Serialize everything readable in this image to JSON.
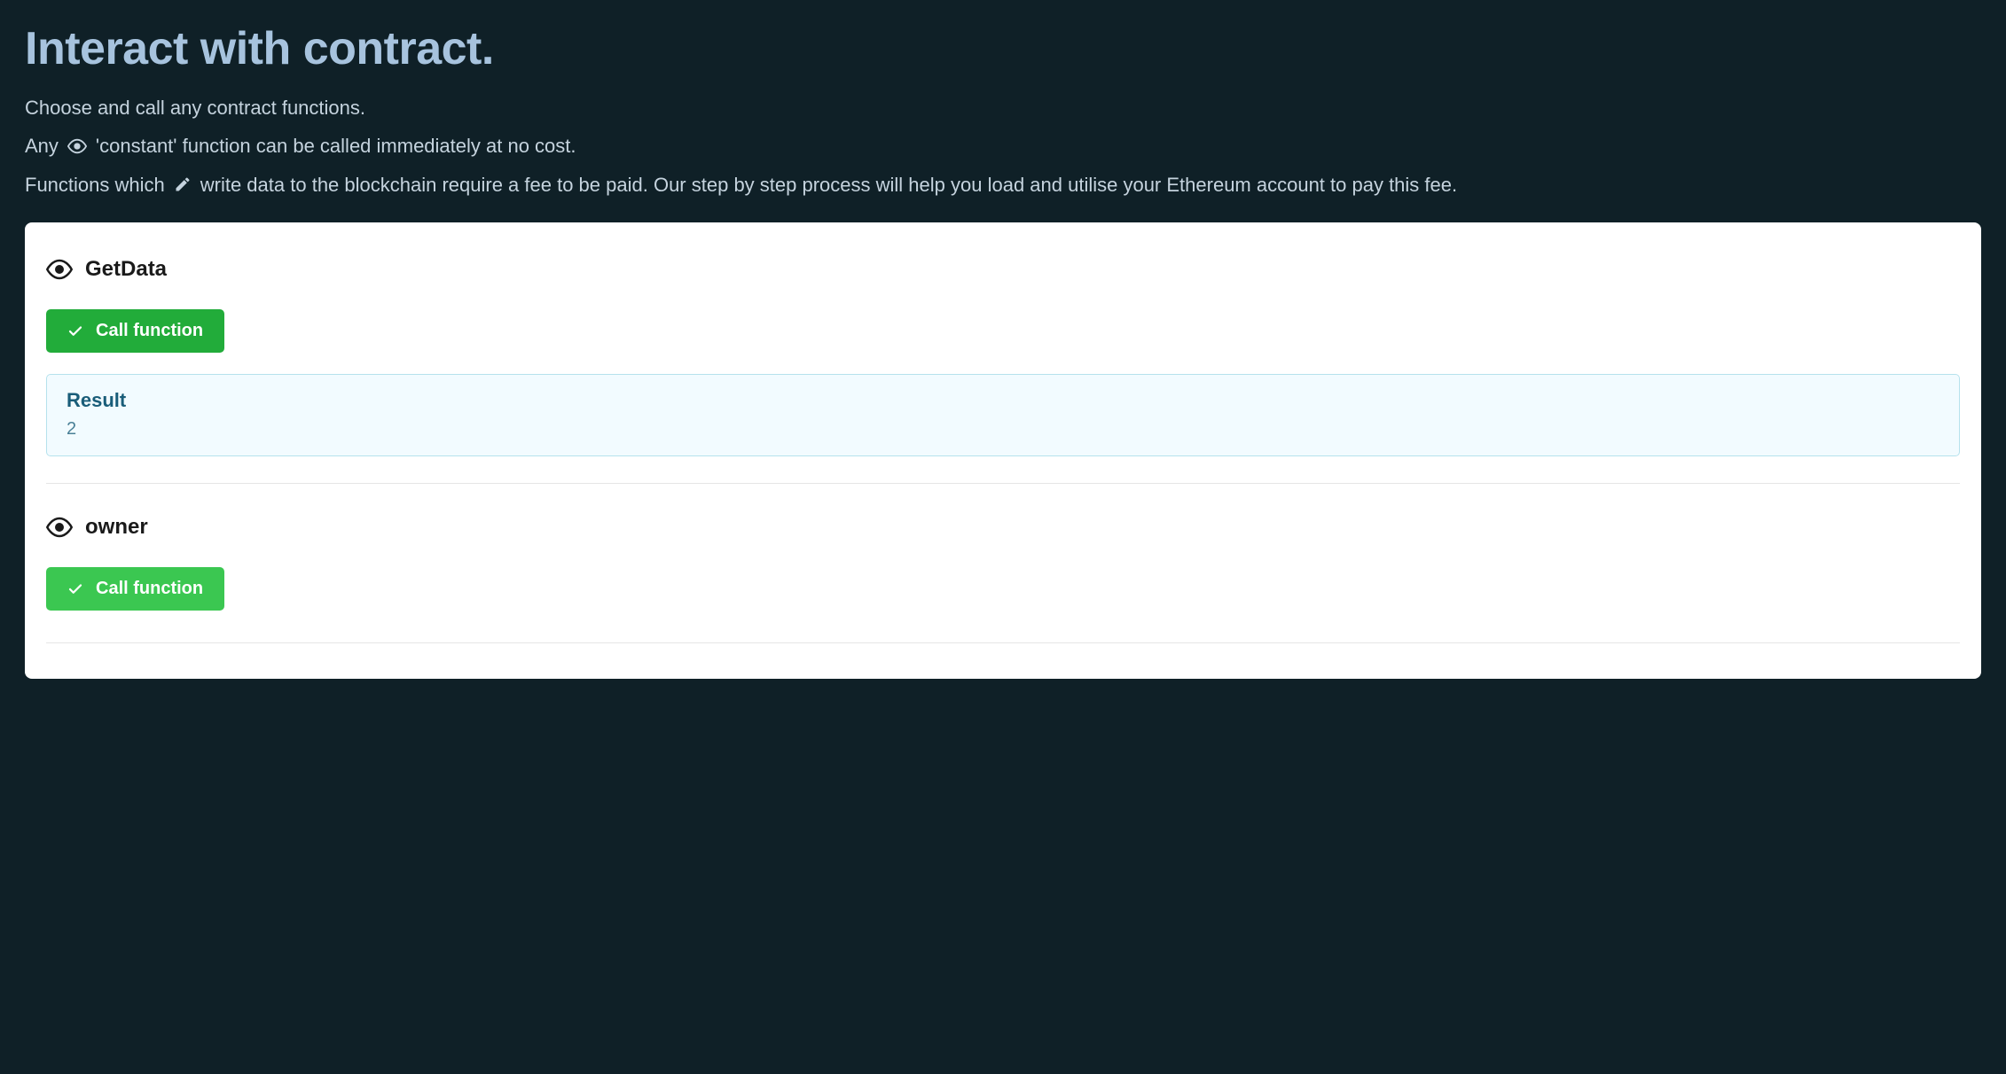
{
  "header": {
    "title": "Interact with contract.",
    "line1": "Choose and call any contract functions.",
    "line2_prefix": "Any",
    "line2_suffix": "'constant' function can be called immediately at no cost.",
    "line3_prefix": "Functions which",
    "line3_suffix": "write data to the blockchain require a fee to be paid. Our step by step process will help you load and utilise your Ethereum account to pay this fee."
  },
  "functions": [
    {
      "name": "GetData",
      "button_label": "Call function",
      "result": {
        "title": "Result",
        "value": "2"
      }
    },
    {
      "name": "owner",
      "button_label": "Call function"
    }
  ]
}
